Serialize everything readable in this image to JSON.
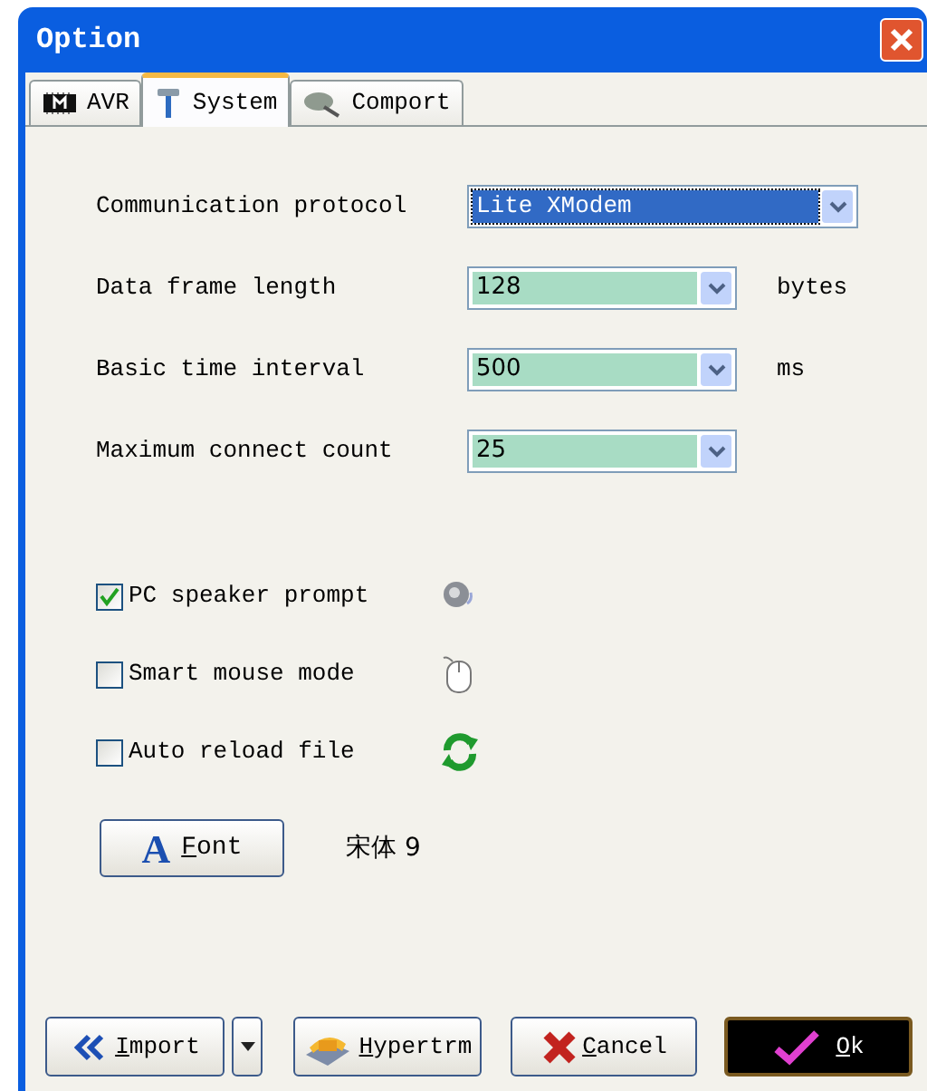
{
  "window": {
    "title": "Option"
  },
  "tabs": [
    {
      "label": "AVR",
      "selected": false
    },
    {
      "label": "System",
      "selected": true
    },
    {
      "label": "Comport",
      "selected": false
    }
  ],
  "settings": [
    {
      "label": "Communication protocol",
      "value": "Lite XModem",
      "focused": true
    },
    {
      "label": "Data frame length",
      "value": "128",
      "focused": false,
      "unit": "bytes"
    },
    {
      "label": "Basic time interval",
      "value": "500",
      "focused": false,
      "unit": "ms"
    },
    {
      "label": "Maximum connect count",
      "value": "25",
      "focused": false
    }
  ],
  "options": [
    {
      "label": "PC speaker prompt",
      "checked": true
    },
    {
      "label": "Smart mouse mode",
      "checked": false
    },
    {
      "label": "Auto reload file",
      "checked": false
    }
  ],
  "font": {
    "icon_glyph": "A",
    "button": "Font",
    "value": "宋体 9"
  },
  "buttons": [
    {
      "label": "Import",
      "kind": "import"
    },
    {
      "kind": "menu"
    },
    {
      "label": "Hypertrm",
      "kind": "hypertrm"
    },
    {
      "label": "Cancel",
      "kind": "cancel"
    },
    {
      "label": "Ok",
      "kind": "ok"
    }
  ]
}
